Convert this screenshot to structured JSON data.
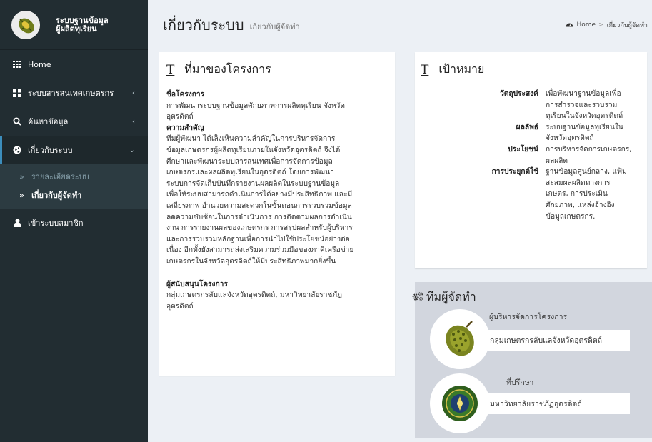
{
  "brand": {
    "line1": "ระบบฐานข้อมูล",
    "line2": "ผู้ผลิตทุเรียน"
  },
  "sidebar": {
    "items": [
      {
        "label": "Home",
        "icon": "grid-icon"
      },
      {
        "label": "ระบบสารสนเทศเกษตรกร",
        "icon": "th-large-icon"
      },
      {
        "label": "ค้นหาข้อมูล",
        "icon": "search-icon"
      },
      {
        "label": "เกี่ยวกับระบบ",
        "icon": "globe-icon"
      },
      {
        "label": "เข้าระบบสมาชิก",
        "icon": "user-icon"
      }
    ],
    "submenu": [
      {
        "label": "รายละเอียดระบบ"
      },
      {
        "label": "เกี่ยวกับผู้จัดทำ"
      }
    ]
  },
  "header": {
    "title": "เกี่ยวกับระบบ",
    "subtitle": "เกี่ยวกับผู้จัดทำ",
    "breadcrumb": {
      "home": "Home",
      "current": "เกี่ยวกับผู้จัดทำ"
    }
  },
  "origin": {
    "title": "ที่มาของโครงการ",
    "project_label": "ชื่อโครงการ",
    "project_text_1": "การพัฒนาระบบฐานข้อมูลศักยภาพการผลิตทุเรียน จังหวัด",
    "project_text_2": "อุตรดิตถ์",
    "importance_label": "ความสำคัญ",
    "importance_lines": [
      "ทีมผู้พัฒนา ได้เล็งเห็นความสำคัญในการบริหารจัดการ",
      "ข้อมูลเกษตรกรผู้ผลิตทุเรียนภายในจังหวัดอุตรดิตถ์ จึงได้",
      "ศึกษาและพัฒนาระบบสารสนเทศเพื่อการจัดการข้อมูล",
      "เกษตรกรและผลผลิตทุเรียนในอุตรดิตถ์ โดยการพัฒนา",
      "ระบบการจัดเก็บบันทึกรายงานผลผลิตในระบบฐานข้อมูล",
      "เพื่อให้ระบบสามารถดำเนินการได้อย่างมีประสิทธิภาพ และมี",
      "เสถียรภาพ อำนวยความสะดวกในขั้นตอนการรวบรวมข้อมูล",
      "ลดความซับซ้อนในการดำเนินการ การติดตามผลการดำเนิน",
      "งาน การรายงานผลของเกษตรกร การสรุปผลสำหรับผู้บริหาร",
      "และการรวบรวมหลักฐานเพื่อการนำไปใช้ประโยชน์อย่างต่อ",
      "เนื่อง อีกทั้งยังสามารถส่งเสริมความร่วมมือของภาคีเครือข่าย",
      "เกษตรกรในจังหวัดอุตรดิตถ์ให้มีประสิทธิภาพมากยิ่งขึ้น"
    ],
    "sponsor_label": "ผู้สนับสนุนโครงการ",
    "sponsor_text_1": "กลุ่มเกษตรกรลับแลจังหวัดอุตรดิตถ์, มหาวิทยาลัยราชภัฏ",
    "sponsor_text_2": "อุตรดิตถ์"
  },
  "goals": {
    "title": "เป้าหมาย",
    "rows": [
      {
        "label": "วัตถุประสงค์",
        "lines": [
          "เพื่อพัฒนาฐานข้อมูลเพื่อ",
          "การสำรวจและรวบรวม",
          "ทุเรียนในจังหวัดอุตรดิตถ์"
        ]
      },
      {
        "label": "ผลลัพธ์",
        "lines": [
          "ระบบฐานข้อมูลทุเรียนใน",
          "จังหวัดอุตรดิตถ์"
        ]
      },
      {
        "label": "ประโยชน์",
        "lines": [
          "การบริหารจัดการเกษตรกร,",
          "ผลผลิต"
        ]
      },
      {
        "label": "การประยุกต์ใช้",
        "lines": [
          "ฐานข้อมูลศูนย์กลาง, แฟ้ม",
          "สะสมผลผลิตทางการ",
          "เกษตร, การประเมิน",
          "ศักยภาพ, แหล่งอ้างอิง",
          "ข้อมูลเกษตรกร."
        ]
      }
    ]
  },
  "team": {
    "title": "ทีมผู้จัดทำ",
    "role1": "ผู้บริหารจัดการโครงการ",
    "name1": "กลุ่มเกษตรกรลับแลจังหวัดอุตรดิตถ์",
    "role2": "ที่ปรึกษา",
    "name2": "มหาวิทยาลัยราชภัฏอุตรดิตถ์"
  },
  "colors": {
    "sidebar": "#222d32",
    "accent": "#3c8dbc",
    "content_bg": "#ecf0f5",
    "durian": "#6b7a1e"
  }
}
